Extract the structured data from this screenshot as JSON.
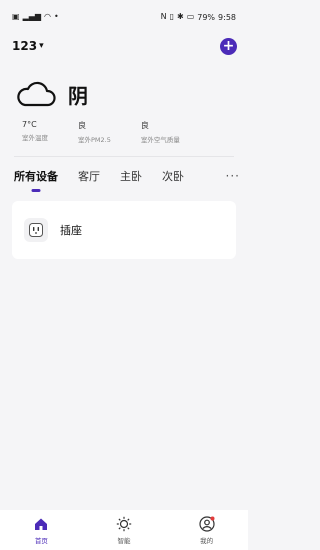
{
  "status_bar": {
    "right_text": "79%",
    "time": "9:58"
  },
  "header": {
    "home_name": "123",
    "add_icon": "plus-circle-icon"
  },
  "weather": {
    "condition": "阴",
    "icon": "cloud-icon",
    "stats": [
      {
        "value": "7°C",
        "label": "室外温度"
      },
      {
        "value": "良",
        "label": "室外PM2.5"
      },
      {
        "value": "良",
        "label": "室外空气质量"
      }
    ]
  },
  "tabs": [
    {
      "label": "所有设备",
      "active": true
    },
    {
      "label": "客厅",
      "active": false
    },
    {
      "label": "主卧",
      "active": false
    },
    {
      "label": "次卧",
      "active": false
    }
  ],
  "more_label": "···",
  "devices": [
    {
      "name": "插座",
      "icon": "socket-icon"
    }
  ],
  "bottom_nav": [
    {
      "label": "首页",
      "icon": "home-icon",
      "active": true
    },
    {
      "label": "智能",
      "icon": "sun-icon",
      "active": false
    },
    {
      "label": "我的",
      "icon": "user-icon",
      "active": false
    }
  ],
  "colors": {
    "accent": "#4b2bb8"
  }
}
